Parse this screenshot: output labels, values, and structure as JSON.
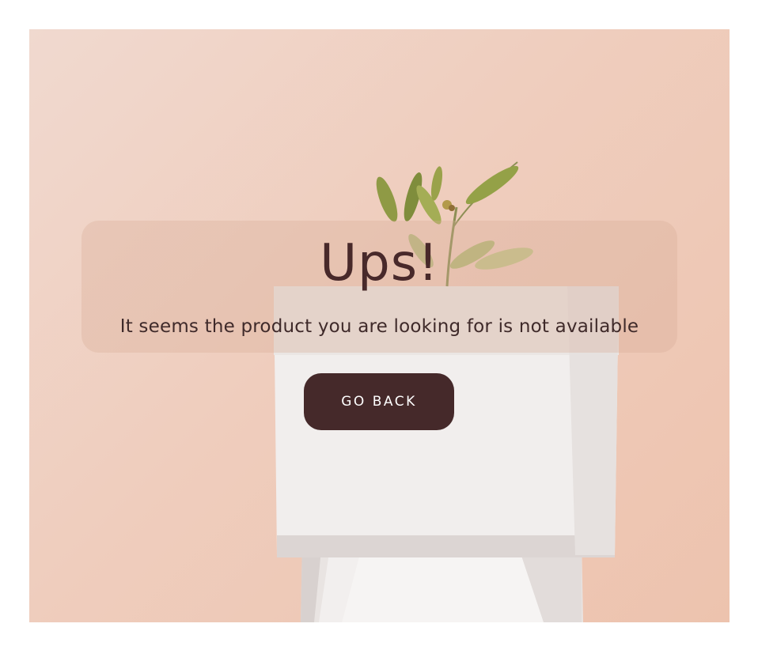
{
  "page": {
    "title": "Ups!",
    "message": "It seems the product you are looking for is not available",
    "go_back_label": "GO BACK"
  },
  "colors": {
    "background_peach": "#efcdbd",
    "text_dark_brown": "#48292a",
    "button_brown": "#45292a",
    "button_text": "#ffffff"
  },
  "hero_image": {
    "subject": "olive-branch-on-white-cube-pedestals"
  }
}
